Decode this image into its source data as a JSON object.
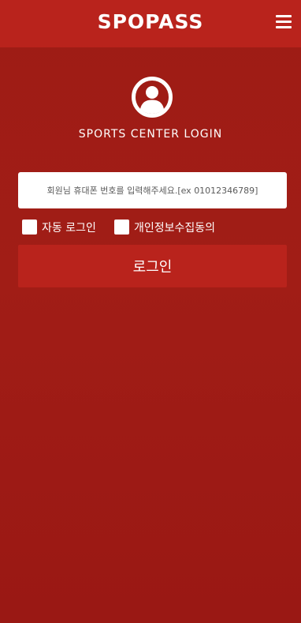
{
  "header": {
    "title": "SPOPASS",
    "menu_icon": "hamburger-menu-icon"
  },
  "login": {
    "avatar_icon": "user-circle-icon",
    "heading": "SPORTS CENTER LOGIN",
    "phone_placeholder": "회원님 휴대폰 번호를 입력해주세요.[ex 01012346789]",
    "phone_value": "",
    "auto_login_label": "자동 로그인",
    "privacy_consent_label": "개인정보수집동의",
    "auto_login_checked": false,
    "privacy_consent_checked": false,
    "submit_label": "로그인"
  },
  "colors": {
    "header_background": "#b9231c",
    "page_background": "#a11d16",
    "button_background": "#b9231c",
    "text": "#ffffff"
  }
}
